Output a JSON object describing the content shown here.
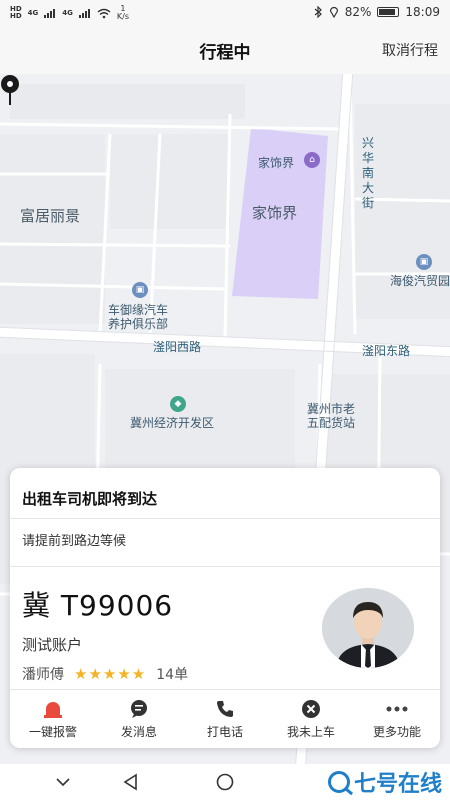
{
  "status_bar": {
    "left_tags": [
      "HD",
      "HD"
    ],
    "net_tags": [
      "4G",
      "4G"
    ],
    "speed_value": "1",
    "speed_unit": "K/s",
    "battery": "82%",
    "time": "18:09"
  },
  "header": {
    "title": "行程中",
    "cancel_label": "取消行程"
  },
  "map": {
    "labels": {
      "fuju": "富居丽景",
      "jiashijie_poi": "家饰界",
      "jiashijie_area": "家饰界",
      "xinghua_road": "兴华南大街",
      "haijun": "海俊汽贸园",
      "chexu_line1": "车御缘汽车",
      "chexu_line2": "养护俱乐部",
      "fuyang_west": "滏阳西路",
      "fuyang_east": "滏阳东路",
      "jizhou_dev": "冀州经济开发区",
      "wupei_line1": "冀州市老",
      "wupei_line2": "五配货站"
    }
  },
  "card": {
    "title": "出租车司机即将到达",
    "subtitle": "请提前到路边等候",
    "plate": "冀 T99006",
    "account": "测试账户",
    "driver_name": "潘师傅",
    "stars": "★★★★★",
    "rating": 5,
    "orders": "14单"
  },
  "actions": [
    {
      "label": "一键报警",
      "icon": "alarm-icon"
    },
    {
      "label": "发消息",
      "icon": "message-icon"
    },
    {
      "label": "打电话",
      "icon": "phone-icon"
    },
    {
      "label": "我未上车",
      "icon": "close-circle-icon"
    },
    {
      "label": "更多功能",
      "icon": "more-icon"
    }
  ],
  "watermark": {
    "text": "七号在线"
  },
  "colors": {
    "alarm": "#e84b3c",
    "star": "#f5b324",
    "poi_area": "#d7ccf5",
    "watermark": "#1f7fc9"
  }
}
